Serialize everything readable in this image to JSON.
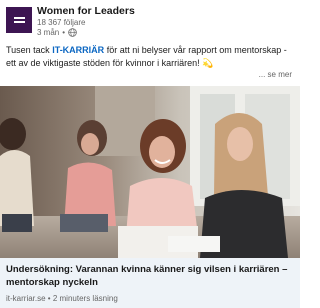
{
  "post": {
    "author": {
      "name": "Women for Leaders",
      "followers": "18 367 följare",
      "age": "3 mån",
      "separator": "•",
      "visibility_icon": "globe-icon"
    },
    "text_before": "Tusen tack ",
    "mention": "IT-KARRIÄR",
    "text_after": " för att ni belyser vår rapport om mentorskap - ett av de viktigaste stöden för kvinnor i karriären! ",
    "emoji": "💫",
    "see_more": "... se mer"
  },
  "link_preview": {
    "title": "Undersökning: Varannan kvinna känner sig vilsen i karriären – mentorskap nyckeln",
    "domain": "it-karriar.se",
    "separator": "•",
    "read_time": "2 minuters läsning"
  },
  "colors": {
    "logo": "#3d1552",
    "mention": "#0a66c2",
    "card_background": "#eef3f8"
  }
}
